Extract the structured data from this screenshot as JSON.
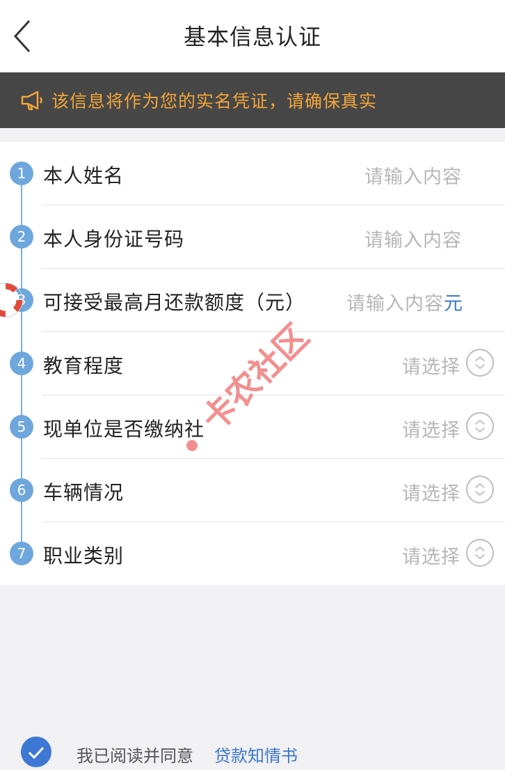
{
  "header": {
    "title": "基本信息认证"
  },
  "notice": {
    "text": "该信息将作为您的实名凭证，请确保真实"
  },
  "form": {
    "rows": [
      {
        "step": "1",
        "label": "本人姓名",
        "placeholder": "请输入内容",
        "type": "input"
      },
      {
        "step": "2",
        "label": "本人身份证号码",
        "placeholder": "请输入内容",
        "type": "input"
      },
      {
        "step": "3",
        "label": "可接受最高月还款额度（元）",
        "placeholder": "请输入内容",
        "unit": "元",
        "type": "input"
      },
      {
        "step": "4",
        "label": "教育程度",
        "placeholder": "请选择",
        "type": "select"
      },
      {
        "step": "5",
        "label": "现单位是否缴纳社",
        "placeholder": "请选择",
        "type": "select"
      },
      {
        "step": "6",
        "label": "车辆情况",
        "placeholder": "请选择",
        "type": "select"
      },
      {
        "step": "7",
        "label": "职业类别",
        "placeholder": "请选择",
        "type": "select"
      }
    ]
  },
  "agreement": {
    "text": "我已阅读并同意",
    "link": "贷款知情书",
    "checked": true
  },
  "watermark": {
    "text": "卡农社区"
  },
  "colors": {
    "accent": "#3c78c8",
    "notice_text": "#f2a53a",
    "notice_bg": "#474747",
    "step": "#6ea7dd"
  }
}
